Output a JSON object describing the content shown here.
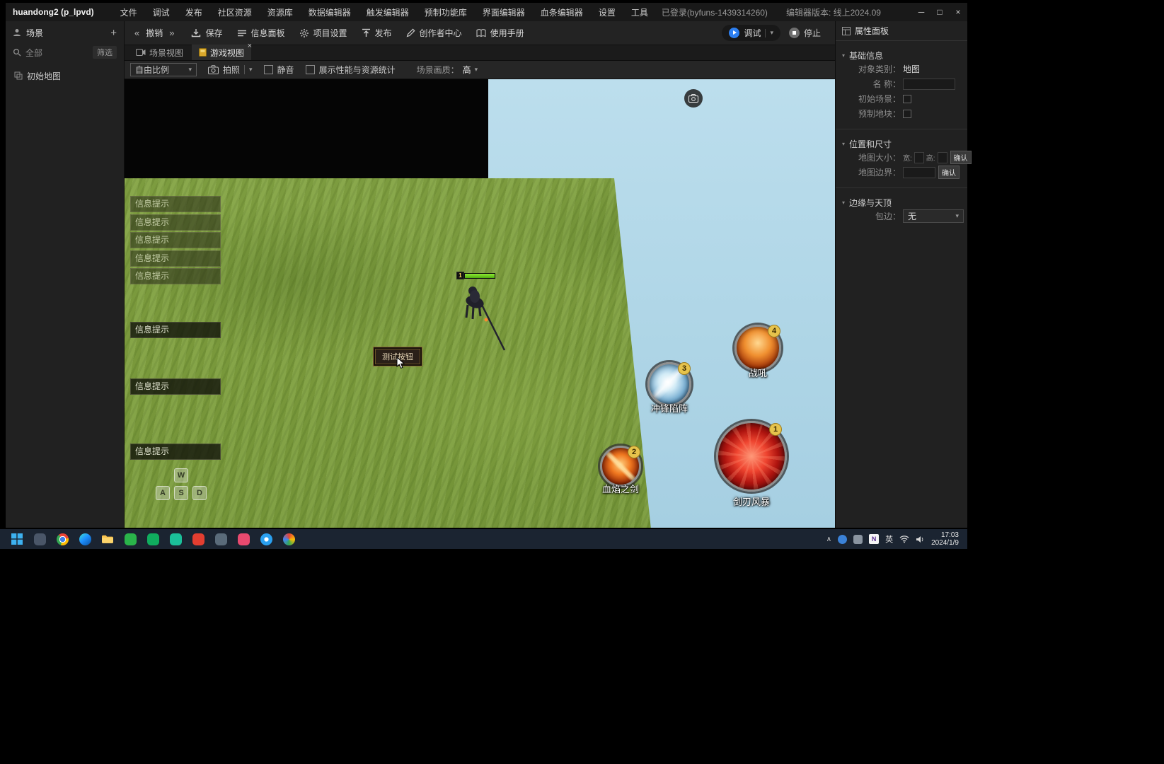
{
  "titlebar": {
    "title": "huandong2 (p_lpvd)",
    "menu": [
      "文件",
      "调试",
      "发布",
      "社区资源",
      "资源库",
      "数据编辑器",
      "触发编辑器",
      "预制功能库",
      "界面编辑器",
      "血条编辑器",
      "设置",
      "工具"
    ],
    "login": "已登录(byfuns-1439314260)",
    "version": "编辑器版本: 线上2024.09"
  },
  "icons": {
    "minimize": "─",
    "maximize": "□",
    "close": "×",
    "caret_down": "▾",
    "undo_chevrons": "«",
    "redo_chevrons": "»",
    "plus": "+",
    "tab_close": "×",
    "tray_chevron": "∧"
  },
  "toolbar": {
    "undo": "撤销",
    "save": "保存",
    "info_panel": "信息面板",
    "project_settings": "项目设置",
    "publish": "发布",
    "creator_center": "创作者中心",
    "manual": "使用手册",
    "debug": "调试",
    "stop": "停止"
  },
  "sidebar": {
    "title": "场景",
    "search": "全部",
    "filter": "筛选",
    "tree": [
      {
        "label": "初始地图"
      }
    ]
  },
  "tabs": {
    "scene": "场景视图",
    "game": "游戏视图"
  },
  "viewport_toolbar": {
    "ratio": "自由比例",
    "photo": "拍照",
    "mute": "静音",
    "stats": "展示性能与资源统计",
    "quality_label": "场景画质：",
    "quality_value": "高"
  },
  "scene": {
    "tips": [
      "信息提示",
      "信息提示",
      "信息提示",
      "信息提示",
      "信息提示",
      "信息提示",
      "信息提示",
      "信息提示"
    ],
    "player_level": "1",
    "test_button": "测试按钮",
    "keys": {
      "w": "W",
      "a": "A",
      "s": "S",
      "d": "D"
    },
    "skills": [
      {
        "name": "战吼",
        "count": "4"
      },
      {
        "name": "冲锋陷阵",
        "count": "3"
      },
      {
        "name": "血焰之剑",
        "count": "2"
      },
      {
        "name": "剑刃风暴",
        "count": "1"
      }
    ]
  },
  "properties": {
    "title": "属性面板",
    "basic": {
      "title": "基础信息",
      "category_label": "对象类别：",
      "category_value": "地图",
      "name_label": "名 称：",
      "initial_scene_label": "初始场景：",
      "prefab_label": "预制地块："
    },
    "size": {
      "title": "位置和尺寸",
      "map_size_label": "地图大小：",
      "width_label": "宽:",
      "height_label": "高:",
      "confirm": "确认",
      "border_label": "地图边界：",
      "confirm2": "确认"
    },
    "edge": {
      "title": "边缘与天顶",
      "wrap_label": "包边：",
      "wrap_value": "无"
    }
  },
  "taskbar": {
    "time": "17:03",
    "date": "2024/1/9",
    "lang": "英"
  },
  "colors": {
    "accent_blue": "#2d7ff0",
    "water": "#aed5e6",
    "grass": "#82a242",
    "badge_yellow": "#e6c34c"
  }
}
